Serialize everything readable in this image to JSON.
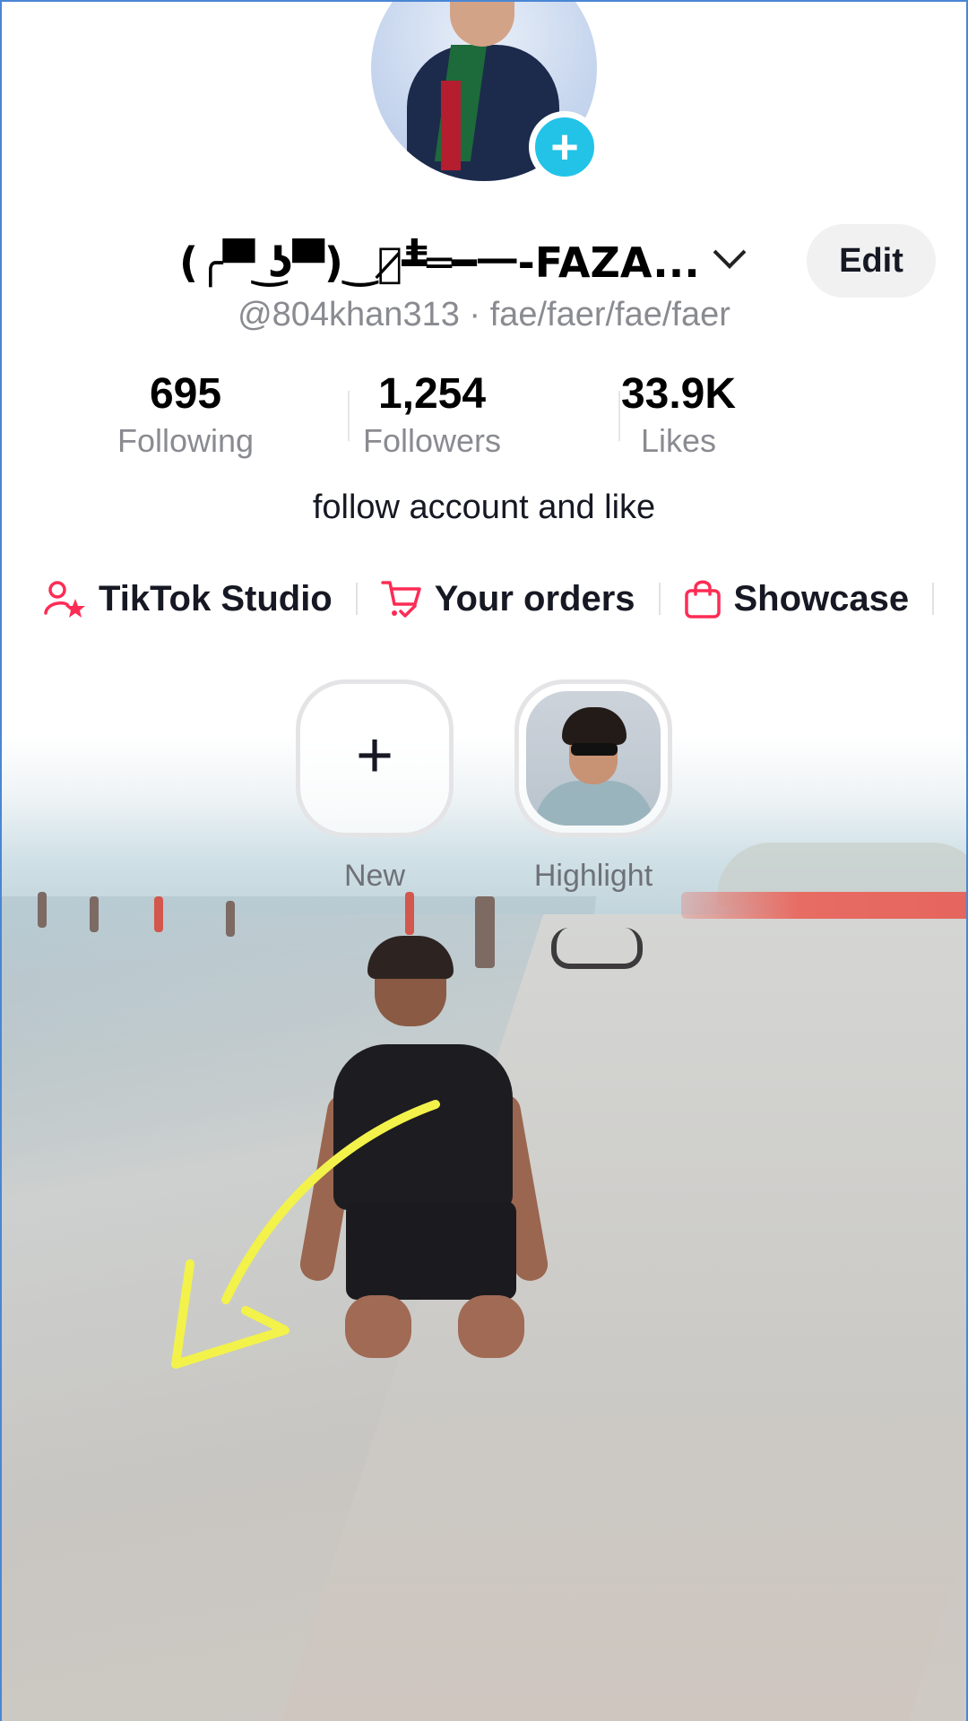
{
  "profile": {
    "display_name": "(╭▀̿ ͜ʖ▀̿)‿︻̷┻̿═━一-FAZA...",
    "username": "@804khan313",
    "pronouns": "fae/faer/fae/faer",
    "handle_separator": " · ",
    "edit_label": "Edit",
    "bio": "follow account and like"
  },
  "stats": [
    {
      "value": "695",
      "label": "Following"
    },
    {
      "value": "1,254",
      "label": "Followers"
    },
    {
      "value": "33.9K",
      "label": "Likes"
    }
  ],
  "links": [
    {
      "label": "TikTok Studio",
      "icon": "user-star-icon"
    },
    {
      "label": "Your orders",
      "icon": "cart-icon"
    },
    {
      "label": "Showcase",
      "icon": "shopping-bag-icon"
    }
  ],
  "highlights": [
    {
      "label": "New",
      "icon": "plus-icon"
    },
    {
      "label": "Highlight",
      "icon": "avatar-thumbnail"
    }
  ],
  "colors": {
    "accent_pink": "#fe2c55",
    "badge_cyan": "#23c3e8",
    "annotation_yellow": "#f2f24a"
  }
}
